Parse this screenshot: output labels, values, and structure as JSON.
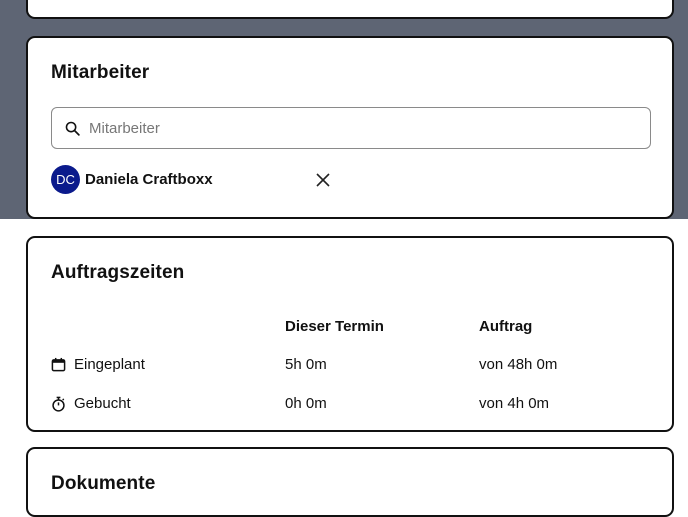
{
  "employees": {
    "title": "Mitarbeiter",
    "search_placeholder": "Mitarbeiter",
    "assignee": {
      "initials": "DC",
      "name": "Daniela Craftboxx"
    }
  },
  "times": {
    "title": "Auftragszeiten",
    "columns": [
      "Dieser Termin",
      "Auftrag"
    ],
    "rows": [
      {
        "icon": "calendar-icon",
        "label": "Eingeplant",
        "termin": "5h 0m",
        "auftrag": "von 48h 0m"
      },
      {
        "icon": "stopwatch-icon",
        "label": "Gebucht",
        "termin": "0h 0m",
        "auftrag": "von 4h 0m"
      }
    ]
  },
  "documents": {
    "title": "Dokumente"
  },
  "colors": {
    "overlay": "#5e6574",
    "avatar": "#0b1a8c",
    "border": "#111111"
  }
}
